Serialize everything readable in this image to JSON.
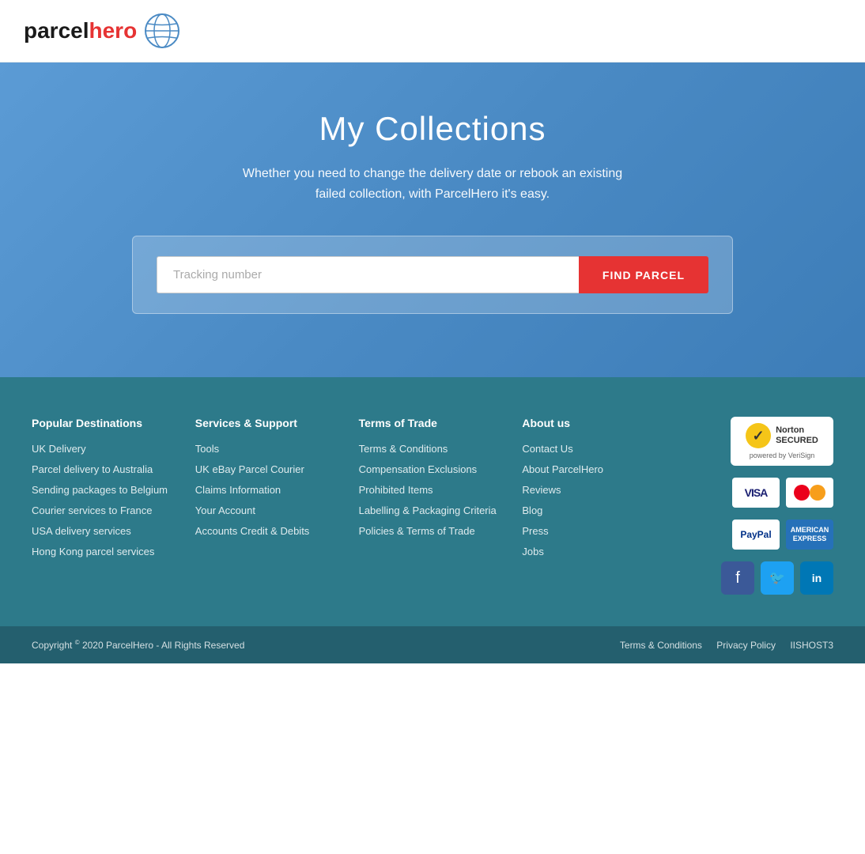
{
  "header": {
    "logo_parcel": "parcel",
    "logo_hero": "hero"
  },
  "hero": {
    "title": "My Collections",
    "subtitle": "Whether you need to change the delivery date or rebook an existing failed collection, with ParcelHero it's easy.",
    "search_placeholder": "Tracking number",
    "find_button_label": "FIND PARCEL"
  },
  "footer": {
    "col1_title": "Popular Destinations",
    "col1_links": [
      "UK Delivery",
      "Parcel delivery to Australia",
      "Sending packages to Belgium",
      "Courier services to France",
      "USA delivery services",
      "Hong Kong parcel services"
    ],
    "col2_title": "Services & Support",
    "col2_links": [
      "Tools",
      "UK eBay Parcel Courier",
      "Claims Information",
      "Your Account",
      "Accounts Credit & Debits"
    ],
    "col3_title": "Terms of Trade",
    "col3_links": [
      "Terms & Conditions",
      "Compensation Exclusions",
      "Prohibited Items",
      "Labelling & Packaging Criteria",
      "Policies & Terms of Trade"
    ],
    "col4_title": "About us",
    "col4_links": [
      "Contact Us",
      "About ParcelHero",
      "Reviews",
      "Blog",
      "Press",
      "Jobs"
    ],
    "norton_line1": "Norton",
    "norton_line2": "SECURED",
    "norton_powered": "powered by VeriSign",
    "visa_label": "VISA",
    "paypal_label": "PayPal",
    "amex_label": "AMERICAN EXPRESS"
  },
  "bottom": {
    "copyright": "Copyright © 2020 ParcelHero - All Rights Reserved",
    "terms_label": "Terms & Conditions",
    "privacy_label": "Privacy Policy",
    "host_label": "IISHOST3"
  }
}
